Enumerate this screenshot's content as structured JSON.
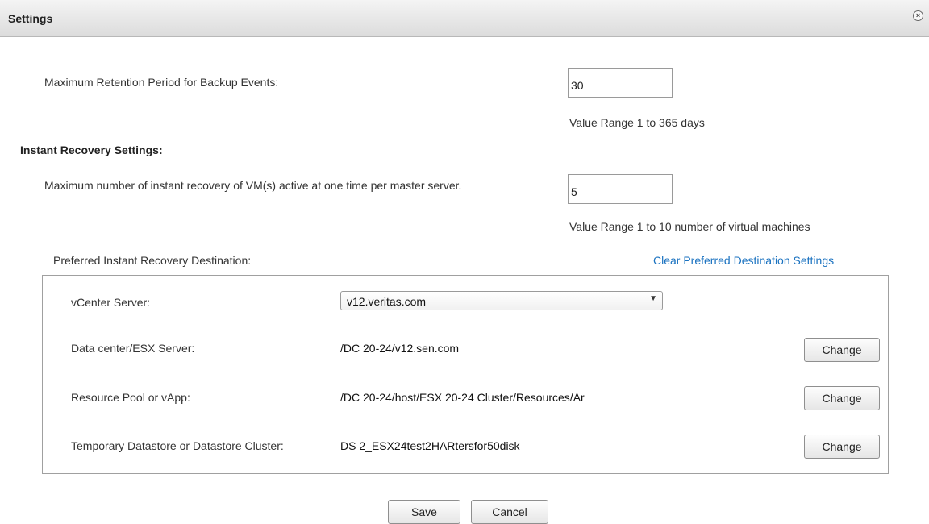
{
  "dialog": {
    "title": "Settings",
    "close_glyph": "×"
  },
  "retention": {
    "label": "Maximum Retention Period for Backup Events:",
    "value": "30",
    "hint": "Value Range 1 to 365 days"
  },
  "instant_recovery": {
    "heading": "Instant Recovery Settings:",
    "max_label": "Maximum number of instant recovery of VM(s) active at one time per master server.",
    "max_value": "5",
    "max_hint": "Value Range 1 to 10 number of virtual machines",
    "destination_label": "Preferred Instant Recovery Destination:",
    "clear_link": "Clear Preferred Destination Settings"
  },
  "destination": {
    "vcenter_label": "vCenter Server:",
    "vcenter_value": "v12.veritas.com",
    "datacenter_label": "Data center/ESX Server:",
    "datacenter_value": "/DC 20-24/v12.sen.com",
    "resource_label": "Resource Pool or vApp:",
    "resource_value": "/DC 20-24/host/ESX 20-24 Cluster/Resources/Ar",
    "datastore_label": "Temporary Datastore or Datastore Cluster:",
    "datastore_value": "DS 2_ESX24test2HARtersfor50disk",
    "change_label": "Change"
  },
  "footer": {
    "save_label": "Save",
    "cancel_label": "Cancel"
  },
  "icons": {
    "close": "close-icon",
    "dropdown": "chevron-down-icon"
  }
}
